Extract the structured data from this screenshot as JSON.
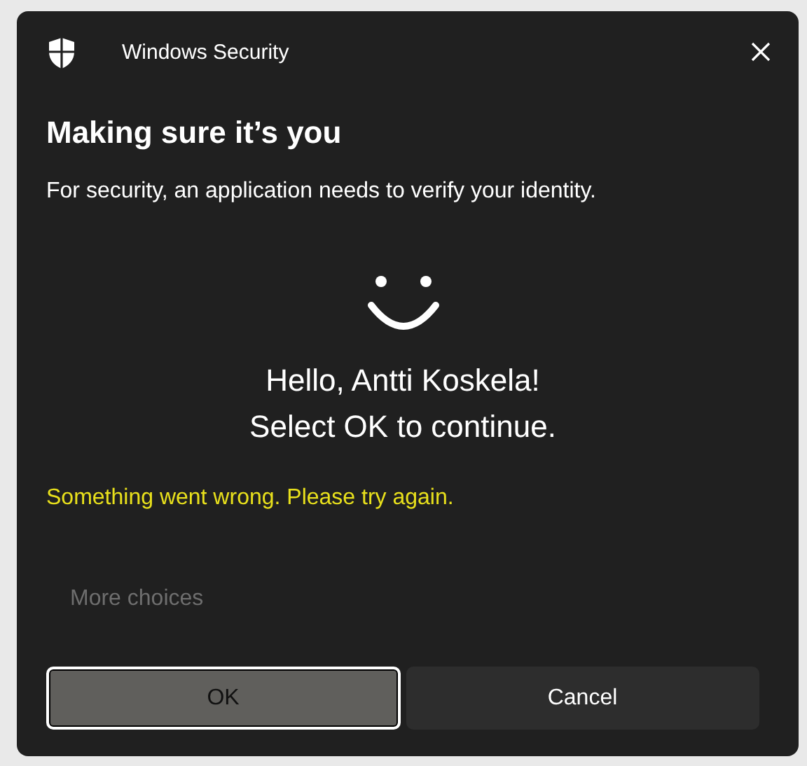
{
  "window": {
    "title": "Windows Security"
  },
  "heading": "Making sure it’s you",
  "description": "For security, an application needs to verify your identity.",
  "greeting": [
    "Hello, Antti Koskela!",
    "Select OK to continue."
  ],
  "error": "Something went wrong. Please try again.",
  "more_choices": {
    "label": "More choices",
    "disabled": true
  },
  "buttons": [
    {
      "label": "OK",
      "kind": "primary",
      "selected": true
    },
    {
      "label": "Cancel",
      "kind": "secondary",
      "selected": false
    }
  ]
}
